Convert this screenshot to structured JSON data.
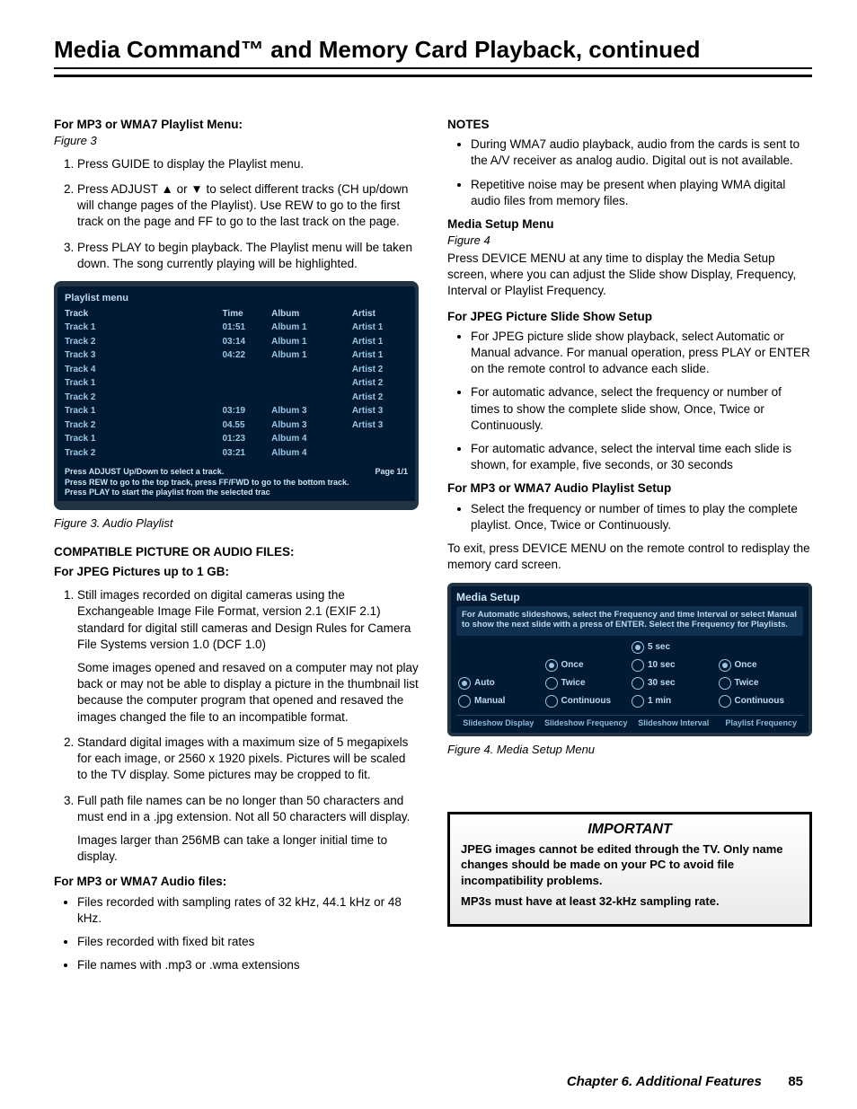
{
  "page_title": "Media Command™ and Memory Card Playback, continued",
  "left": {
    "h_playlist": "For MP3 or WMA7 Playlist Menu:",
    "fig3_ref": "Figure 3",
    "steps": [
      "Press GUIDE to display the Playlist menu.",
      "Press ADJUST ▲ or ▼ to select different tracks (CH up/down will change pages of the Playlist).  Use REW to go to the first track on the page and FF to go to the last track on the page.",
      "Press PLAY to begin playback.  The Playlist menu will be taken down. The song currently playing will be highlighted."
    ],
    "playlist": {
      "title": "Playlist menu",
      "columns": [
        "Track",
        "Time",
        "Album",
        "Artist"
      ],
      "rows": [
        [
          "Track 1",
          "01:51",
          "Album 1",
          "Artist 1"
        ],
        [
          "Track 2",
          "03:14",
          "Album 1",
          "Artist 1"
        ],
        [
          "Track 3",
          "04:22",
          "Album 1",
          "Artist 1"
        ],
        [
          "Track 4",
          "",
          "",
          "Artist 2"
        ],
        [
          "Track 1",
          "",
          "",
          "Artist 2"
        ],
        [
          "Track 2",
          "",
          "",
          "Artist 2"
        ],
        [
          "Track 1",
          "03:19",
          "Album 3",
          "Artist 3"
        ],
        [
          "Track 2",
          "04.55",
          "Album 3",
          "Artist 3"
        ],
        [
          "Track 1",
          "01:23",
          "Album 4",
          ""
        ],
        [
          "Track 2",
          "03:21",
          "Album 4",
          ""
        ]
      ],
      "tips": [
        "Press ADJUST Up/Down to select a track.",
        "Press REW to go to the top track, press FF/FWD to go to the bottom track.",
        "Press PLAY to start the playlist from the selected trac"
      ],
      "pageno": "Page 1/1"
    },
    "fig3_caption": "Figure 3.  Audio Playlist",
    "h_compat1": "COMPATIBLE PICTURE OR AUDIO FILES:",
    "h_compat2": "For JPEG Pictures up to 1 GB:",
    "compat_steps": [
      {
        "p1": "Still images recorded on digital cameras using the Exchangeable Image File Format, version 2.1 (EXIF 2.1) standard for digital still cameras and Design Rules for Camera File Systems version 1.0 (DCF 1.0)",
        "p2": "Some images opened and resaved on a computer may not play back or may not be able to display a picture in the thumbnail list because the computer program that opened and resaved the images changed the file to an incompatible format."
      },
      {
        "p1": "Standard digital images with a maximum size of 5 megapixels for each image, or 2560 x 1920 pixels.  Pictures will be scaled to the TV display.  Some pictures may be cropped to fit."
      },
      {
        "p1": "Full path file names can be no longer than 50 characters and must end in a .jpg extension.  Not all 50 characters will display.",
        "p2": "Images larger than 256MB can take a longer initial time to display."
      }
    ],
    "h_audiofiles": "For MP3 or WMA7 Audio files:",
    "audio_bullets": [
      "Files recorded with sampling rates of 32 kHz, 44.1 kHz or 48 kHz.",
      "Files recorded with fixed bit rates",
      "File names with .mp3 or .wma extensions"
    ]
  },
  "right": {
    "h_notes": "NOTES",
    "notes": [
      "During WMA7 audio playback, audio from the cards is sent to the A/V receiver as analog audio.  Digital out is not available.",
      "Repetitive noise may be present when playing WMA digital audio files from memory files."
    ],
    "h_msetup": "Media Setup Menu",
    "fig4_ref": "Figure 4",
    "msetup_p": "Press DEVICE MENU at any time to display the Media Setup screen, where you can adjust the Slide show Display, Frequency, Interval or Playlist Frequency.",
    "h_jpeg": "For JPEG Picture Slide Show Setup",
    "jpeg_bullets": [
      "For JPEG picture slide show playback, select Automatic or Manual advance.  For manual operation, press PLAY or ENTER on the remote control to advance each slide.",
      "For automatic advance, select the frequency or number of times to show the complete slide show, Once, Twice or Continuously.",
      "For automatic advance, select the interval time each slide is shown, for example, five seconds, or 30 seconds"
    ],
    "h_mp3setup": "For MP3 or WMA7 Audio Playlist Setup",
    "mp3setup_bullets": [
      "Select the frequency or number of times to play the complete playlist.  Once, Twice or Continuously."
    ],
    "exit_p": "To exit, press DEVICE MENU on the remote control to redisplay the memory card screen.",
    "msetup_ui": {
      "title": "Media Setup",
      "help": "For Automatic slideshows, select the Frequency and time Interval or select Manual to show the next slide with a press of ENTER. Select the Frequency for Playlists.",
      "colA": {
        "opts": [
          {
            "label": "Auto",
            "sel": true
          },
          {
            "label": "Manual",
            "sel": false
          }
        ]
      },
      "colB": {
        "opts": [
          {
            "label": "Once",
            "sel": true
          },
          {
            "label": "Twice",
            "sel": false
          },
          {
            "label": "Continuous",
            "sel": false
          }
        ]
      },
      "colC": {
        "opts": [
          {
            "label": "5 sec",
            "sel": true
          },
          {
            "label": "10 sec",
            "sel": false
          },
          {
            "label": "30 sec",
            "sel": false
          },
          {
            "label": "1 min",
            "sel": false
          }
        ]
      },
      "colD": {
        "opts": [
          {
            "label": "Once",
            "sel": true
          },
          {
            "label": "Twice",
            "sel": false
          },
          {
            "label": "Continuous",
            "sel": false
          }
        ]
      },
      "col_labels": [
        "Slideshow Display",
        "Slideshow Frequency",
        "Slideshow Interval",
        "Playlist Frequency"
      ]
    },
    "fig4_caption": "Figure 4.  Media Setup Menu"
  },
  "important": {
    "title": "IMPORTANT",
    "p1": "JPEG images cannot be edited through the TV.  Only name changes should be made on your PC to avoid file incompatibility problems.",
    "p2": "MP3s must have at least 32-kHz sampling rate."
  },
  "footer": {
    "chapter": "Chapter 6. Additional Features",
    "page": "85"
  }
}
